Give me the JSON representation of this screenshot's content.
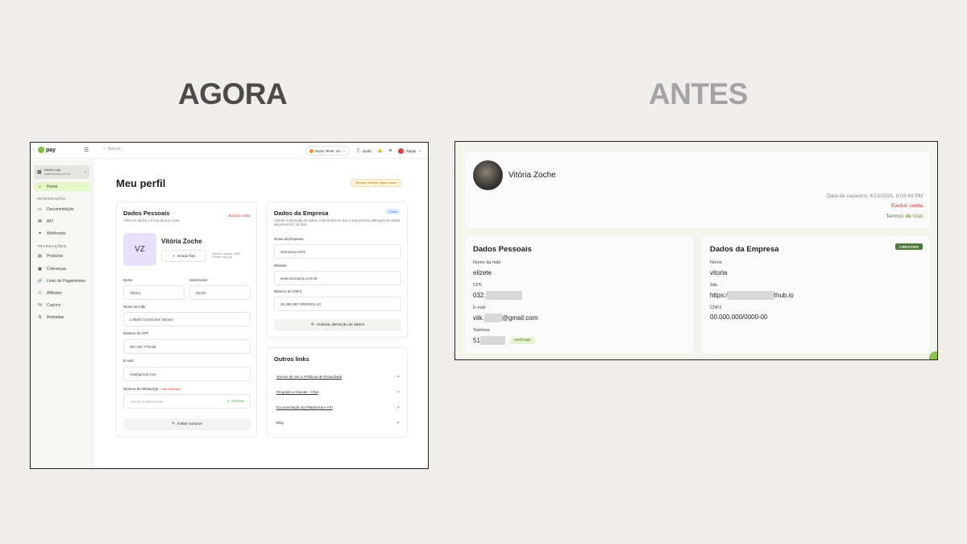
{
  "headings": {
    "agora": "AGORA",
    "antes": "ANTES"
  },
  "agora": {
    "topbar": {
      "logo": "pay",
      "search_placeholder": "Buscar...",
      "modo_teste": "Modo Teste: On",
      "ajuda": "Ajuda",
      "user": "Rappi"
    },
    "sidebar": {
      "store_name": "Vitoria's Loja",
      "store_sub": "va@example.com.br",
      "home": "Home",
      "section_integracao": "INTEGRAÇÃO",
      "integracao": [
        "Documentação",
        "API",
        "Webhooks"
      ],
      "section_transacoes": "TRANSAÇÕES",
      "transacoes": [
        "Produtos",
        "Cobranças",
        "Links de Pagamentos",
        "Afiliados",
        "Cupons",
        "Retiradas"
      ]
    },
    "page_title": "Meu perfil",
    "warning": "Atenção: verifique alguns dados",
    "dados_pessoais": {
      "title": "Dados Pessoais",
      "subtitle": "Altere os dados e a foto da sua conta",
      "excluir": "Excluir conta",
      "avatar_initials": "VZ",
      "name": "Vitória Zoche",
      "enviar_foto": "Enviar foto",
      "photo_note_1": "Tamanho máximo: 25MB",
      "photo_note_2": "Formato: png, jpg",
      "labels": {
        "nome": "Nome",
        "sobrenome": "Sobrenome",
        "mae": "Nome da mãe",
        "cpf": "Número do CPF",
        "email": "E-mail",
        "whatsapp": "Número do WhatsApp"
      },
      "values": {
        "nome": "Vitória",
        "sobrenome": "Zoche",
        "mae": "Lisbeth Cunha dos Santos",
        "cpf": "087.067.778-89",
        "email": "vzp@gmail.com"
      },
      "whatsapp_status": "Não verificado",
      "whatsapp_placeholder": "+55 00 0 0000-0000",
      "verificar": "verificar",
      "editar": "Editar campos"
    },
    "dados_empresa": {
      "title": "Dados da Empresa",
      "badge": "Criado",
      "subtitle": "Solicite a alteração de dados, mas lembre-se que a sua próxima alteração só estará disponível em 15 dias.",
      "labels": {
        "nome": "Nome da Empresa",
        "website": "Website",
        "cnpj": "Número do CNPJ"
      },
      "values": {
        "nome": "vitoriazop eireli",
        "website": "www.vitoriazop.com.br",
        "cnpj": "32.456.897.905/0001-23"
      },
      "solicitar": "Solicitar alteração de dados"
    },
    "outros_links": {
      "title": "Outros links",
      "items": [
        "Termos de Uso e Políticas de Privacidade",
        "Pergunte a Abacate - Chat",
        "Documentação da Plataforma e API",
        "Blog"
      ]
    }
  },
  "antes": {
    "name": "Vitória Zoche",
    "date": "Data de cadastro: 4/13/2025, 8:03:49 PM",
    "excluir": "Excluir conta",
    "termos": "Termos de Uso",
    "dados_pessoais": {
      "title": "Dados Pessoais",
      "labels": {
        "mae": "Nome da mãe",
        "cpf": "CPF",
        "email": "E-mail",
        "telefone": "Telefone"
      },
      "values": {
        "mae": "elizete",
        "cpf_prefix": "032.",
        "email_prefix": "viik.",
        "email_suffix": "@gmail.com",
        "telefone_prefix": "51"
      },
      "verificado": "Verificado"
    },
    "dados_empresa": {
      "title": "Dados da Empresa",
      "badge": "CREATED",
      "labels": {
        "nome": "Nome",
        "site": "Site",
        "cnpj": "CNPJ"
      },
      "values": {
        "nome": "vitoria",
        "site_prefix": "https:/",
        "site_suffix": "thub.io",
        "cnpj": "00.000.000/0000-00"
      }
    }
  }
}
